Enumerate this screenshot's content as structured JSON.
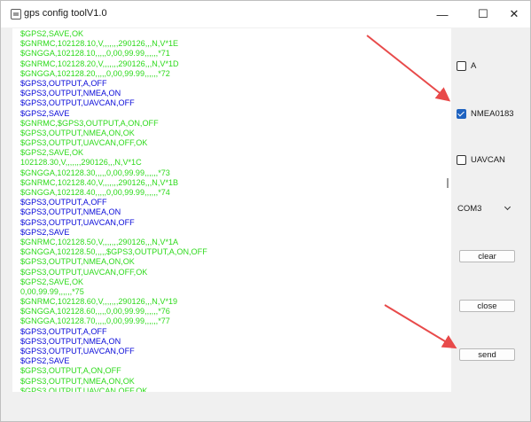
{
  "window": {
    "title": "gps config toolV1.0",
    "minimize_glyph": "—",
    "maximize_glyph": "☐",
    "close_glyph": "✕"
  },
  "log": {
    "lines": [
      {
        "text": "$GPS2,SAVE,OK",
        "color": "green"
      },
      {
        "text": "$GNRMC,102128.10,V,,,,,,,290126,,,N,V*1E",
        "color": "green"
      },
      {
        "text": "$GNGGA,102128.10,,,,,0,00,99.99,,,,,,*71",
        "color": "green"
      },
      {
        "text": "$GNRMC,102128.20,V,,,,,,,290126,,,N,V*1D",
        "color": "green"
      },
      {
        "text": "$GNGGA,102128.20,,,,,0,00,99.99,,,,,,*72",
        "color": "green"
      },
      {
        "text": "$GPS3,OUTPUT,A,OFF",
        "color": "blue"
      },
      {
        "text": "$GPS3,OUTPUT,NMEA,ON",
        "color": "blue"
      },
      {
        "text": "$GPS3,OUTPUT,UAVCAN,OFF",
        "color": "blue"
      },
      {
        "text": "$GPS2,SAVE",
        "color": "blue"
      },
      {
        "text": "$GNRMC,$GPS3,OUTPUT,A,ON,OFF",
        "color": "green"
      },
      {
        "text": "$GPS3,OUTPUT,NMEA,ON,OK",
        "color": "green"
      },
      {
        "text": "$GPS3,OUTPUT,UAVCAN,OFF,OK",
        "color": "green"
      },
      {
        "text": "$GPS2,SAVE,OK",
        "color": "green"
      },
      {
        "text": "102128.30,V,,,,,,,290126,,,N,V*1C",
        "color": "green"
      },
      {
        "text": "$GNGGA,102128.30,,,,,0,00,99.99,,,,,,*73",
        "color": "green"
      },
      {
        "text": "$GNRMC,102128.40,V,,,,,,,290126,,,N,V*1B",
        "color": "green"
      },
      {
        "text": "$GNGGA,102128.40,,,,,0,00,99.99,,,,,,*74",
        "color": "green"
      },
      {
        "text": "$GPS3,OUTPUT,A,OFF",
        "color": "blue"
      },
      {
        "text": "$GPS3,OUTPUT,NMEA,ON",
        "color": "blue"
      },
      {
        "text": "$GPS3,OUTPUT,UAVCAN,OFF",
        "color": "blue"
      },
      {
        "text": "$GPS2,SAVE",
        "color": "blue"
      },
      {
        "text": "$GNRMC,102128.50,V,,,,,,,290126,,,N,V*1A",
        "color": "green"
      },
      {
        "text": "$GNGGA,102128.50,,,,,$GPS3,OUTPUT,A,ON,OFF",
        "color": "green"
      },
      {
        "text": "$GPS3,OUTPUT,NMEA,ON,OK",
        "color": "green"
      },
      {
        "text": "$GPS3,OUTPUT,UAVCAN,OFF,OK",
        "color": "green"
      },
      {
        "text": "$GPS2,SAVE,OK",
        "color": "green"
      },
      {
        "text": "0,00,99.99,,,,,,*75",
        "color": "green"
      },
      {
        "text": "$GNRMC,102128.60,V,,,,,,,290126,,,N,V*19",
        "color": "green"
      },
      {
        "text": "$GNGGA,102128.60,,,,,0,00,99.99,,,,,,*76",
        "color": "green"
      },
      {
        "text": "$GNGGA,102128.70,,,,,0,00,99.99,,,,,,*77",
        "color": "green"
      },
      {
        "text": "$GPS3,OUTPUT,A,OFF",
        "color": "blue"
      },
      {
        "text": "$GPS3,OUTPUT,NMEA,ON",
        "color": "blue"
      },
      {
        "text": "$GPS3,OUTPUT,UAVCAN,OFF",
        "color": "blue"
      },
      {
        "text": "$GPS2,SAVE",
        "color": "blue"
      },
      {
        "text": "$GPS3,OUTPUT,A,ON,OFF",
        "color": "green"
      },
      {
        "text": "$GPS3,OUTPUT,NMEA,ON,OK",
        "color": "green"
      },
      {
        "text": "$GPS3,OUTPUT,UAVCAN,OFF,OK",
        "color": "green"
      }
    ]
  },
  "options": {
    "a": {
      "label": "A",
      "checked": false
    },
    "nmea0183": {
      "label": "NMEA0183",
      "checked": true
    },
    "uavcan": {
      "label": "UAVCAN",
      "checked": false
    }
  },
  "port": {
    "selected": "COM3"
  },
  "buttons": {
    "clear": "clear",
    "close": "close",
    "send": "send"
  },
  "colors": {
    "green_text": "#2eda1c",
    "blue_text": "#0a0ad8",
    "checkbox_accent": "#1f63c0",
    "annotation_arrow": "#e84a4a"
  }
}
